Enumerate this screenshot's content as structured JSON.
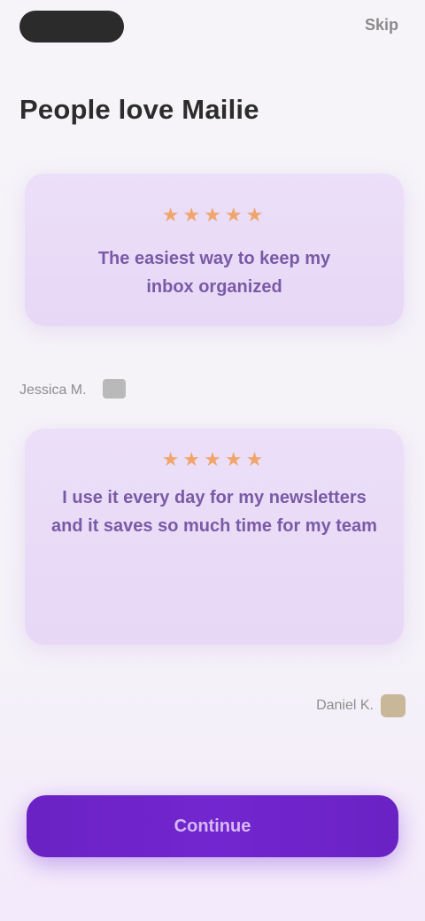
{
  "header": {
    "skip_label": "Skip"
  },
  "page": {
    "title": "People love Mailie"
  },
  "reviews": [
    {
      "stars": "★★★★★",
      "text": "The easiest way to keep my inbox organized",
      "reviewer": "Jessica M."
    },
    {
      "stars": "★★★★★",
      "text": "I use it every day for my newsletters and it saves so much time for my team",
      "reviewer": "Daniel K."
    }
  ],
  "cta": {
    "label": "Continue"
  },
  "colors": {
    "accent": "#6a22c4",
    "card": "#e9dbf7",
    "star": "#f0a56c"
  }
}
